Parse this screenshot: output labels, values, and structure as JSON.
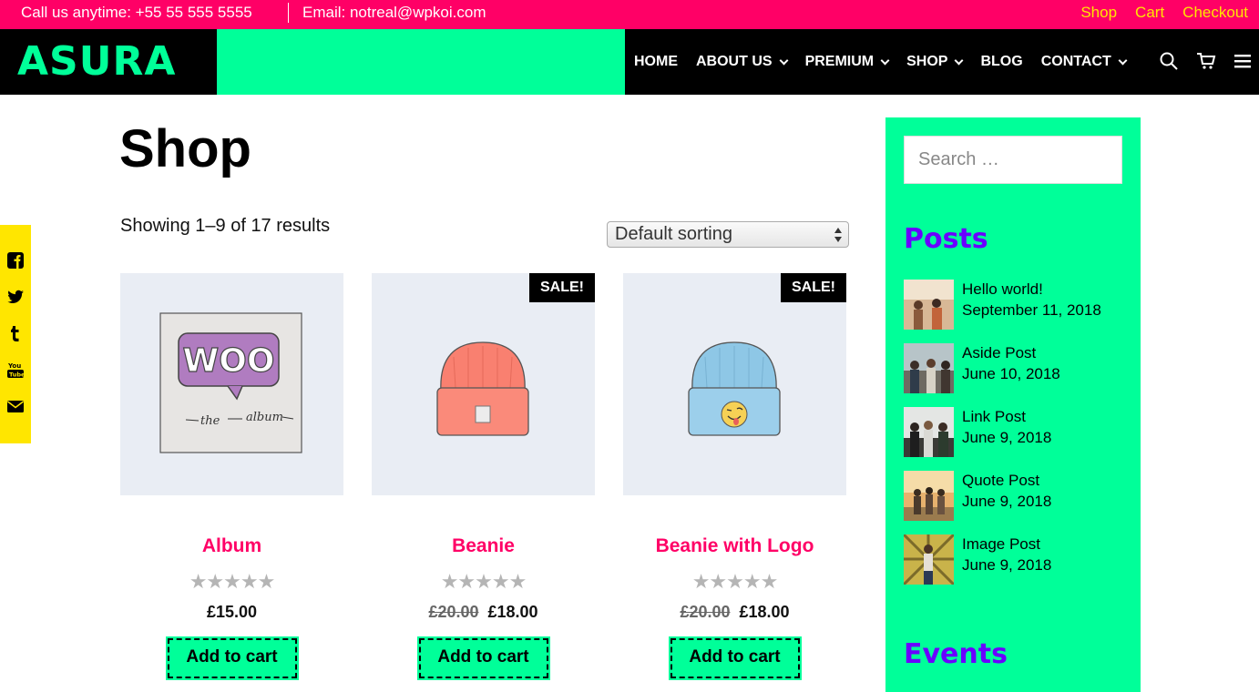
{
  "topbar": {
    "phone": "Call us anytime: +55 55 555 5555",
    "email": "Email: notreal@wpkoi.com",
    "links": [
      "Shop",
      "Cart",
      "Checkout"
    ]
  },
  "header": {
    "logo": "ASURA",
    "nav": [
      {
        "label": "HOME",
        "dropdown": false
      },
      {
        "label": "ABOUT US",
        "dropdown": true
      },
      {
        "label": "PREMIUM",
        "dropdown": true
      },
      {
        "label": "SHOP",
        "dropdown": true
      },
      {
        "label": "BLOG",
        "dropdown": false
      },
      {
        "label": "CONTACT",
        "dropdown": true
      }
    ],
    "icons": [
      "search-icon",
      "cart-icon",
      "menu-icon"
    ]
  },
  "social": [
    "facebook-icon",
    "twitter-icon",
    "tumblr-icon",
    "youtube-icon",
    "envelope-icon"
  ],
  "main": {
    "title": "Shop",
    "result_count": "Showing 1–9 of 17 results",
    "sort_selected": "Default sorting",
    "products": [
      {
        "name": "Album",
        "price": "£15.00",
        "old_price": "",
        "sale": "",
        "button": "Add to cart",
        "rating": 0
      },
      {
        "name": "Beanie",
        "price": "£18.00",
        "old_price": "£20.00",
        "sale": "SALE!",
        "button": "Add to cart",
        "rating": 0
      },
      {
        "name": "Beanie with Logo",
        "price": "£18.00",
        "old_price": "£20.00",
        "sale": "SALE!",
        "button": "Add to cart",
        "rating": 0
      }
    ],
    "stars": "★★★★★"
  },
  "album_art": {
    "word": "WOO",
    "caption_1": "the",
    "caption_2": "album"
  },
  "sidebar": {
    "search_placeholder": "Search …",
    "posts_title": "Posts",
    "posts": [
      {
        "title": "Hello world!",
        "date": "September 11, 2018"
      },
      {
        "title": "Aside Post",
        "date": "June 10, 2018"
      },
      {
        "title": "Link Post",
        "date": "June 9, 2018"
      },
      {
        "title": "Quote Post",
        "date": "June 9, 2018"
      },
      {
        "title": "Image Post",
        "date": "June 9, 2018"
      }
    ],
    "events_title": "Events"
  },
  "colors": {
    "pink": "#ff0066",
    "green": "#00ff99",
    "yellow": "#ffe600",
    "purple": "#6a00ff"
  }
}
